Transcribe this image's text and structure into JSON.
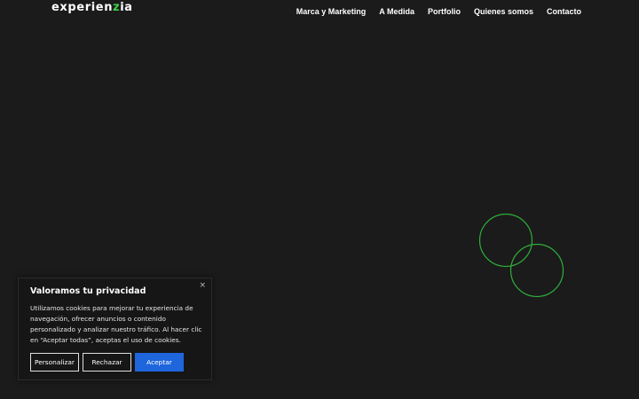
{
  "header": {
    "logo_prefix": "experien",
    "logo_accent": "z",
    "logo_suffix": "ia",
    "nav": [
      "Marca y Marketing",
      "A Medida",
      "Portfolio",
      "Quienes somos",
      "Contacto"
    ]
  },
  "colors": {
    "background": "#1b1b1b",
    "accent": "#3ad14a",
    "primary_button": "#1f66dc"
  },
  "cookie": {
    "close": "×",
    "title": "Valoramos tu privacidad",
    "text": "Utilizamos cookies para mejorar tu experiencia de navegación, ofrecer anuncios o contenido personalizado y analizar nuestro tráfico. Al hacer clic en “Aceptar todas”, aceptas el uso de cookies.",
    "buttons": {
      "customize": "Personalizar",
      "reject": "Rechazar",
      "accept": "Aceptar"
    }
  }
}
